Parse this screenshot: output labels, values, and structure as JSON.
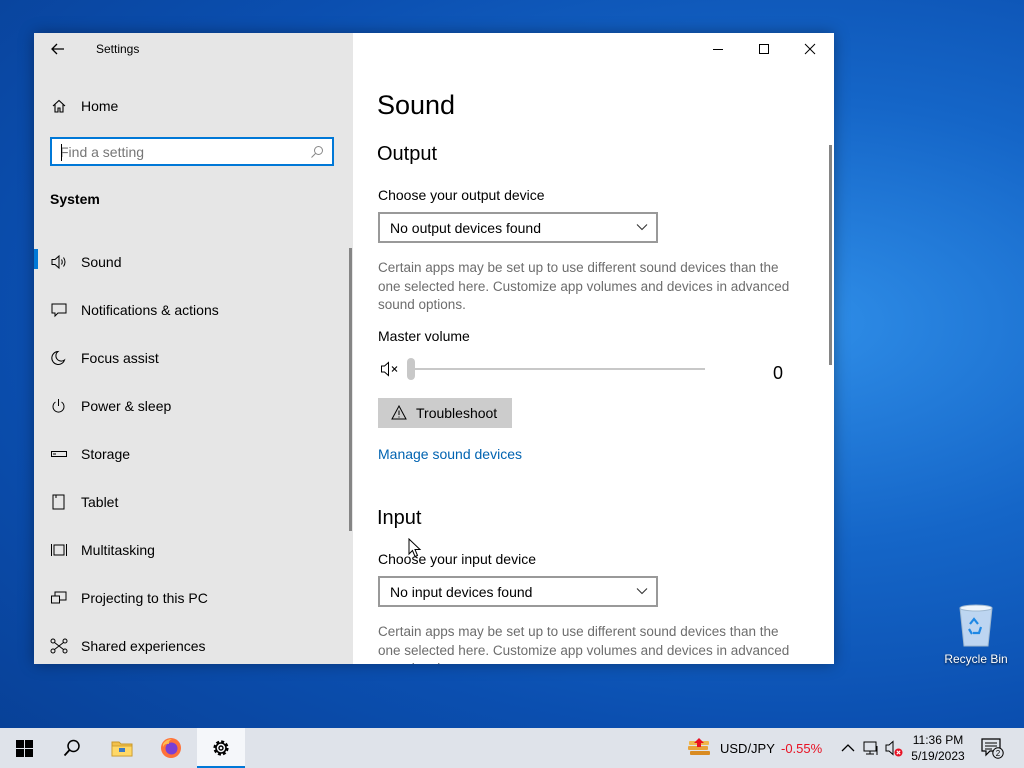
{
  "window": {
    "app_title": "Settings",
    "controls": {
      "minimize": "minimize-icon",
      "maximize": "maximize-icon",
      "close": "close-icon"
    }
  },
  "sidebar": {
    "home_label": "Home",
    "search_placeholder": "Find a setting",
    "group_label": "System",
    "items": [
      {
        "label": "Sound",
        "icon": "speaker-icon",
        "active": true
      },
      {
        "label": "Notifications & actions",
        "icon": "notification-icon",
        "active": false
      },
      {
        "label": "Focus assist",
        "icon": "moon-icon",
        "active": false
      },
      {
        "label": "Power & sleep",
        "icon": "power-icon",
        "active": false
      },
      {
        "label": "Storage",
        "icon": "storage-icon",
        "active": false
      },
      {
        "label": "Tablet",
        "icon": "tablet-icon",
        "active": false
      },
      {
        "label": "Multitasking",
        "icon": "multitasking-icon",
        "active": false
      },
      {
        "label": "Projecting to this PC",
        "icon": "projecting-icon",
        "active": false
      },
      {
        "label": "Shared experiences",
        "icon": "shared-icon",
        "active": false
      }
    ]
  },
  "content": {
    "page_title": "Sound",
    "output": {
      "title": "Output",
      "device_label": "Choose your output device",
      "device_value": "No output devices found",
      "description": "Certain apps may be set up to use different sound devices than the one selected here. Customize app volumes and devices in advanced sound options.",
      "volume_label": "Master volume",
      "volume_value": "0",
      "troubleshoot_label": "Troubleshoot",
      "manage_link": "Manage sound devices"
    },
    "input": {
      "title": "Input",
      "device_label": "Choose your input device",
      "device_value": "No input devices found",
      "description": "Certain apps may be set up to use different sound devices than the one selected here. Customize app volumes and devices in advanced sound options."
    }
  },
  "desktop": {
    "recycle_bin_label": "Recycle Bin"
  },
  "taskbar": {
    "ticker_name": "USD/JPY",
    "ticker_change": "-0.55%",
    "time": "11:36 PM",
    "date": "5/19/2023",
    "notification_count": "2"
  },
  "colors": {
    "accent": "#0078d7",
    "link": "#0063b1",
    "negative": "#e81123"
  }
}
